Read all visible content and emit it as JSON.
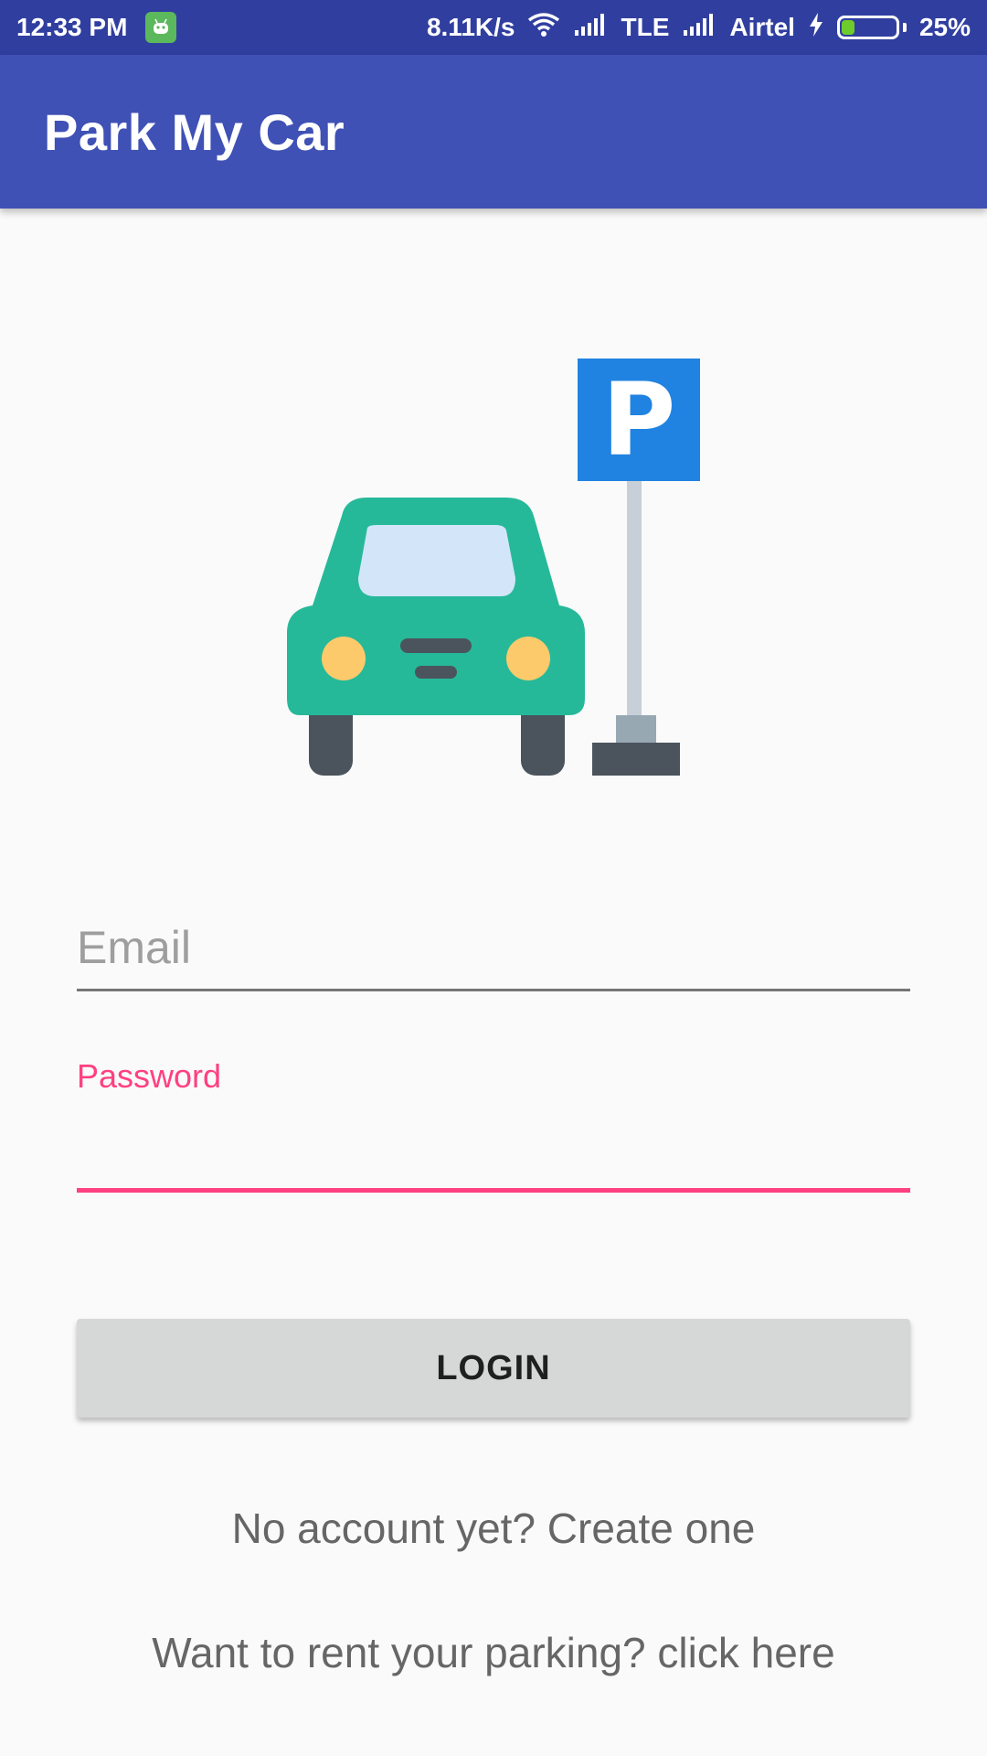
{
  "status_bar": {
    "time": "12:33 PM",
    "speed": "8.11K/s",
    "network_type": "TLE",
    "carrier": "Airtel",
    "battery": "25%",
    "battery_level": 0.25,
    "accent_color": "#303f9f"
  },
  "app_bar": {
    "title": "Park My Car",
    "color": "#3f51b5"
  },
  "illustration": {
    "parking_sign_letter": "P",
    "icon": "car-parking-icon"
  },
  "form": {
    "email": {
      "placeholder": "Email",
      "value": ""
    },
    "password": {
      "label": "Password",
      "value": "",
      "accent_color": "#ff4081"
    },
    "login_label": "LOGIN"
  },
  "links": {
    "create_account": "No account yet? Create one",
    "rent_parking": "Want to rent your parking? click here"
  }
}
